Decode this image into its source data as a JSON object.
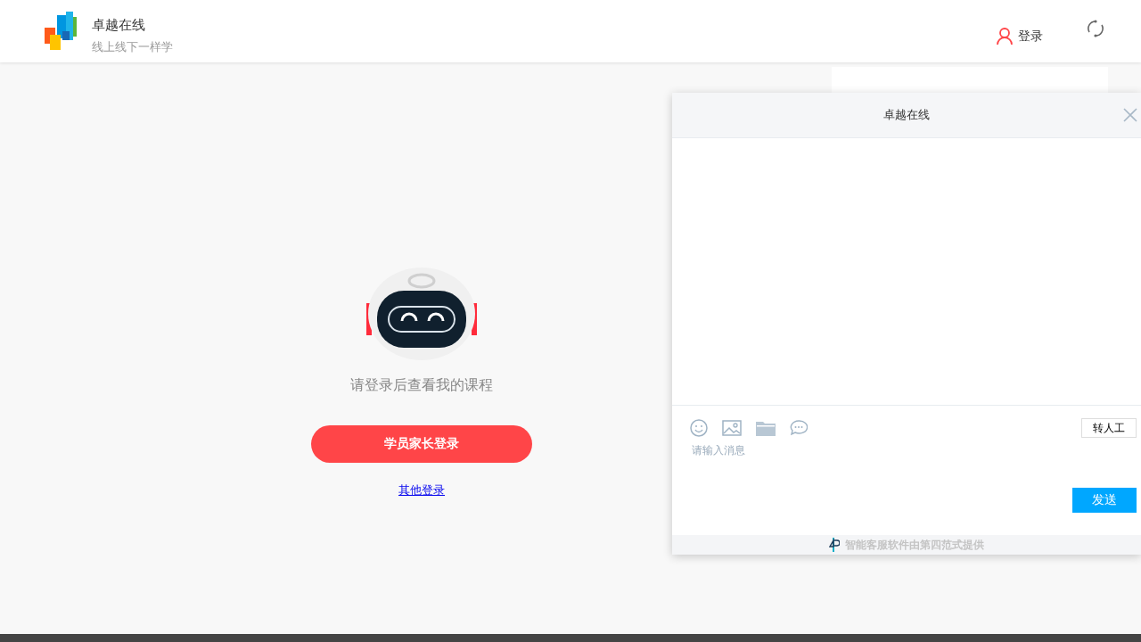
{
  "header": {
    "title": "卓越在线",
    "subtitle": "线上线下一样学",
    "login": "登录"
  },
  "main": {
    "prompt": "请登录后查看我的课程",
    "login_button": "学员家长登录",
    "other_login": "其他登录"
  },
  "chat": {
    "title": "卓越在线",
    "placeholder": "请输入消息",
    "transfer": "转人工",
    "send": "发送",
    "footer": "智能客服软件由第四范式提供"
  }
}
